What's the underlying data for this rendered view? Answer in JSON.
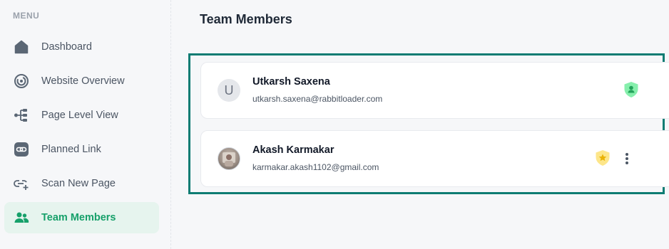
{
  "sidebar": {
    "menu_label": "MENU",
    "items": [
      {
        "label": "Dashboard",
        "icon": "home-icon"
      },
      {
        "label": "Website Overview",
        "icon": "overview-ring-icon"
      },
      {
        "label": "Page Level View",
        "icon": "hierarchy-icon"
      },
      {
        "label": "Planned Link",
        "icon": "link-icon"
      },
      {
        "label": "Scan New Page",
        "icon": "add-link-icon"
      },
      {
        "label": "Team Members",
        "icon": "users-icon",
        "active": true
      }
    ]
  },
  "main": {
    "title": "Team Members",
    "members": [
      {
        "initial": "U",
        "name": "Utkarsh Saxena",
        "email": "utkarsh.saxena@rabbitloader.com",
        "role_icon": "user-shield-icon"
      },
      {
        "initial": "",
        "name": "Akash Karmakar",
        "email": "karmakar.akash1102@gmail.com",
        "role_icon": "star-shield-icon"
      }
    ]
  },
  "colors": {
    "accent": "#16a06a",
    "highlight_border": "#0e7c73",
    "member_badge": "#86efac",
    "owner_badge": "#fde68a"
  }
}
